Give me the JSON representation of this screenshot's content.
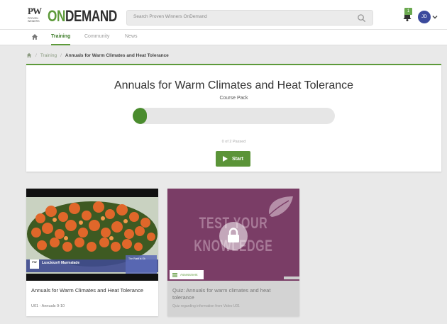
{
  "brand": {
    "logo_mark": "PW",
    "logo_tagline": "PROVEN WINNERS",
    "on": "ON",
    "demand": "DEMAND"
  },
  "search": {
    "placeholder": "Search Proven Winners OnDemand"
  },
  "user": {
    "notification_count": "1",
    "initials": "JD"
  },
  "nav": {
    "items": [
      {
        "label": "Training",
        "active": true
      },
      {
        "label": "Community",
        "active": false
      },
      {
        "label": "News",
        "active": false
      }
    ]
  },
  "breadcrumb": {
    "training": "Training",
    "current": "Annuals for Warm Climates and Heat Tolerance"
  },
  "course": {
    "title": "Annuals for Warm Climates and Heat Tolerance",
    "subtitle": "Course Pack",
    "progress_fraction": 0.04,
    "progress_text": "0 of 2 Passed",
    "start_label": "Start"
  },
  "cards": [
    {
      "plant_name": "Luscious® Marmalade",
      "label_card_text": "The Plant is Ok",
      "title": "Annuals for Warm Climates and Heat Tolerance",
      "meta": "U01 - Annuals 9-10"
    },
    {
      "thumb_line1": "TEST YOUR",
      "thumb_line2": "KNOWLEDGE",
      "badge": "Assessment",
      "title": "Quiz: Annuals for warm climates and heat tolerance",
      "meta": "Quiz regarding information from Video U01"
    }
  ],
  "colors": {
    "accent": "#5d9a3a",
    "accent_dark": "#4a8c2e",
    "quiz_purple": "#7a3d66",
    "avatar_blue": "#3b4a9c"
  },
  "icons": [
    "search-icon",
    "bell-icon",
    "chevron-down-icon",
    "home-icon",
    "play-icon",
    "leaf-icon",
    "lock-icon",
    "assessment-icon"
  ]
}
